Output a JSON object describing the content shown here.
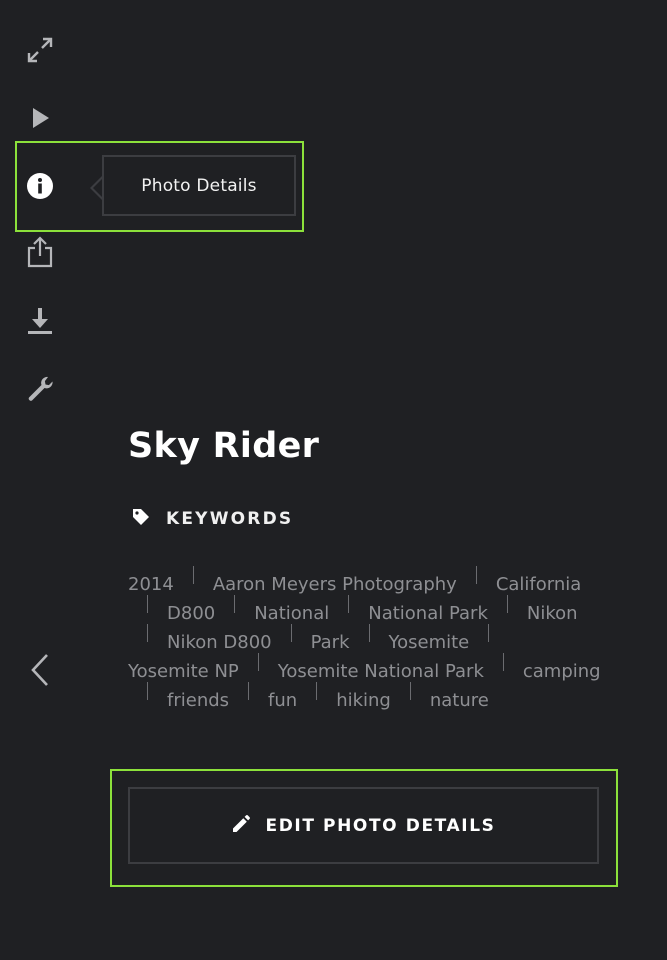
{
  "rail": {
    "icons": [
      "expand-icon",
      "play-icon",
      "info-icon",
      "share-icon",
      "download-icon",
      "wrench-icon",
      "chevron-left-icon"
    ]
  },
  "tooltip": {
    "text": "Photo Details"
  },
  "photo": {
    "title": "Sky Rider",
    "keywords_label": "KEYWORDS",
    "keywords": [
      "2014",
      "Aaron Meyers Photography",
      "California",
      "D800",
      "National",
      "National Park",
      "Nikon",
      "Nikon D800",
      "Park",
      "Yosemite",
      "Yosemite NP",
      "Yosemite National Park",
      "camping",
      "friends",
      "fun",
      "hiking",
      "nature"
    ]
  },
  "edit_button": {
    "label": "EDIT PHOTO DETAILS"
  },
  "colors": {
    "background": "#1f2023",
    "highlight": "#8ce13b",
    "border": "#3c3d41",
    "keyword_text": "#8e8f93",
    "icon": "#b5b6b9"
  }
}
